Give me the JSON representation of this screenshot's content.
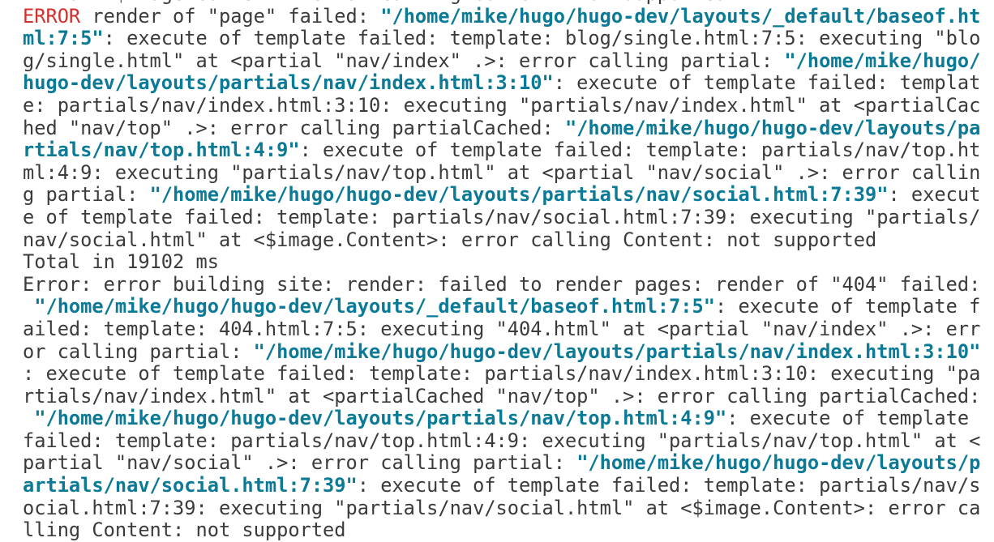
{
  "colors": {
    "text": "#3b3b3b",
    "link": "#0b7a96",
    "error": "#d0312d",
    "background": "#ffffff"
  },
  "lines": [
    [
      {
        "style": "text",
        "t": "ml\" at <$image.Content>: error calling Content: not supported"
      }
    ],
    [
      {
        "style": "err",
        "t": "ERROR"
      },
      {
        "style": "text",
        "t": " render of \"page\" failed: "
      },
      {
        "style": "link",
        "t": "\"/home/mike/hugo/hugo-dev/layouts/_default/baseof.ht"
      }
    ],
    [
      {
        "style": "link",
        "t": "ml:7:5\""
      },
      {
        "style": "text",
        "t": ": execute of template failed: template: blog/single.html:7:5: executing \"blo"
      }
    ],
    [
      {
        "style": "text",
        "t": "g/single.html\" at <partial \"nav/index\" .>: error calling partial: "
      },
      {
        "style": "link",
        "t": "\"/home/mike/hugo/"
      }
    ],
    [
      {
        "style": "link",
        "t": "hugo-dev/layouts/partials/nav/index.html:3:10\""
      },
      {
        "style": "text",
        "t": ": execute of template failed: templat"
      }
    ],
    [
      {
        "style": "text",
        "t": "e: partials/nav/index.html:3:10: executing \"partials/nav/index.html\" at <partialCac"
      }
    ],
    [
      {
        "style": "text",
        "t": "hed \"nav/top\" .>: error calling partialCached: "
      },
      {
        "style": "link",
        "t": "\"/home/mike/hugo/hugo-dev/layouts/pa"
      }
    ],
    [
      {
        "style": "link",
        "t": "rtials/nav/top.html:4:9\""
      },
      {
        "style": "text",
        "t": ": execute of template failed: template: partials/nav/top.ht"
      }
    ],
    [
      {
        "style": "text",
        "t": "ml:4:9: executing \"partials/nav/top.html\" at <partial \"nav/social\" .>: error callin"
      }
    ],
    [
      {
        "style": "text",
        "t": "g partial: "
      },
      {
        "style": "link",
        "t": "\"/home/mike/hugo/hugo-dev/layouts/partials/nav/social.html:7:39\""
      },
      {
        "style": "text",
        "t": ": execut"
      }
    ],
    [
      {
        "style": "text",
        "t": "e of template failed: template: partials/nav/social.html:7:39: executing \"partials/"
      }
    ],
    [
      {
        "style": "text",
        "t": "nav/social.html\" at <$image.Content>: error calling Content: not supported"
      }
    ],
    [
      {
        "style": "text",
        "t": "Total in 19102 ms"
      }
    ],
    [
      {
        "style": "text",
        "t": "Error: error building site: render: failed to render pages: render of \"404\" failed:"
      }
    ],
    [
      {
        "style": "text",
        "t": " "
      },
      {
        "style": "link",
        "t": "\"/home/mike/hugo/hugo-dev/layouts/_default/baseof.html:7:5\""
      },
      {
        "style": "text",
        "t": ": execute of template f"
      }
    ],
    [
      {
        "style": "text",
        "t": "ailed: template: 404.html:7:5: executing \"404.html\" at <partial \"nav/index\" .>: err"
      }
    ],
    [
      {
        "style": "text",
        "t": "or calling partial: "
      },
      {
        "style": "link",
        "t": "\"/home/mike/hugo/hugo-dev/layouts/partials/nav/index.html:3:10\""
      }
    ],
    [
      {
        "style": "text",
        "t": ": execute of template failed: template: partials/nav/index.html:3:10: executing \"pa"
      }
    ],
    [
      {
        "style": "text",
        "t": "rtials/nav/index.html\" at <partialCached \"nav/top\" .>: error calling partialCached:"
      }
    ],
    [
      {
        "style": "text",
        "t": " "
      },
      {
        "style": "link",
        "t": "\"/home/mike/hugo/hugo-dev/layouts/partials/nav/top.html:4:9\""
      },
      {
        "style": "text",
        "t": ": execute of template "
      }
    ],
    [
      {
        "style": "text",
        "t": "failed: template: partials/nav/top.html:4:9: executing \"partials/nav/top.html\" at <"
      }
    ],
    [
      {
        "style": "text",
        "t": "partial \"nav/social\" .>: error calling partial: "
      },
      {
        "style": "link",
        "t": "\"/home/mike/hugo/hugo-dev/layouts/p"
      }
    ],
    [
      {
        "style": "link",
        "t": "artials/nav/social.html:7:39\""
      },
      {
        "style": "text",
        "t": ": execute of template failed: template: partials/nav/s"
      }
    ],
    [
      {
        "style": "text",
        "t": "ocial.html:7:39: executing \"partials/nav/social.html\" at <$image.Content>: error ca"
      }
    ],
    [
      {
        "style": "text",
        "t": "lling Content: not supported"
      }
    ]
  ]
}
